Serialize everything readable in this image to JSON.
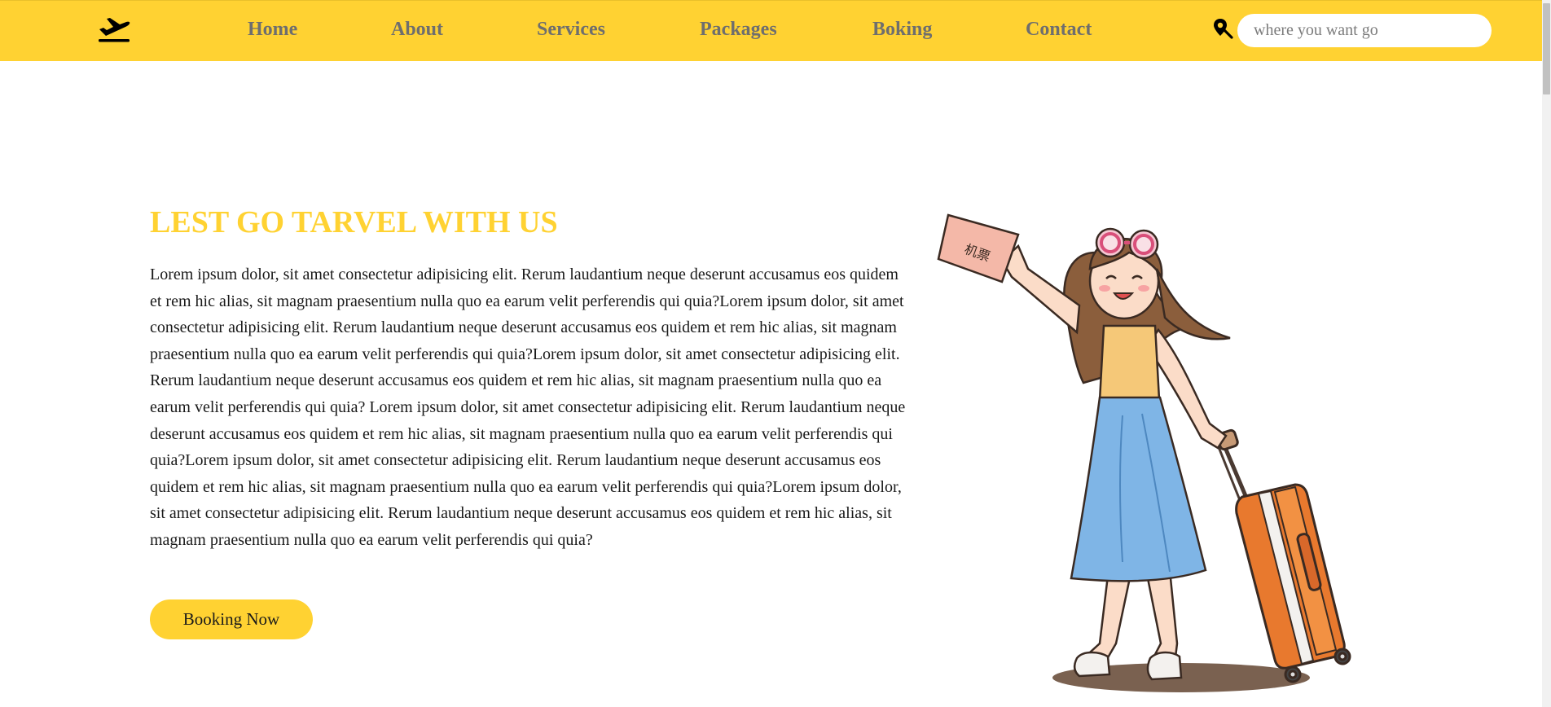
{
  "header": {
    "logo_icon": "plane-departure-icon",
    "nav": [
      {
        "label": "Home"
      },
      {
        "label": "About"
      },
      {
        "label": "Services"
      },
      {
        "label": "Packages"
      },
      {
        "label": "Boking"
      },
      {
        "label": "Contact"
      }
    ],
    "search": {
      "icon": "location-search-icon",
      "placeholder": "where you want go",
      "value": ""
    }
  },
  "hero": {
    "title": "LEST GO TARVEL WITH US",
    "body": "Lorem ipsum dolor, sit amet consectetur adipisicing elit. Rerum laudantium neque deserunt accusamus eos quidem et rem hic alias, sit magnam praesentium nulla quo ea earum velit perferendis qui quia?Lorem ipsum dolor, sit amet consectetur adipisicing elit. Rerum laudantium neque deserunt accusamus eos quidem et rem hic alias, sit magnam praesentium nulla quo ea earum velit perferendis qui quia?Lorem ipsum dolor, sit amet consectetur adipisicing elit. Rerum laudantium neque deserunt accusamus eos quidem et rem hic alias, sit magnam praesentium nulla quo ea earum velit perferendis qui quia? Lorem ipsum dolor, sit amet consectetur adipisicing elit. Rerum laudantium neque deserunt accusamus eos quidem et rem hic alias, sit magnam praesentium nulla quo ea earum velit perferendis qui quia?Lorem ipsum dolor, sit amet consectetur adipisicing elit. Rerum laudantium neque deserunt accusamus eos quidem et rem hic alias, sit magnam praesentium nulla quo ea earum velit perferendis qui quia?Lorem ipsum dolor, sit amet consectetur adipisicing elit. Rerum laudantium neque deserunt accusamus eos quidem et rem hic alias, sit magnam praesentium nulla quo ea earum velit perferendis qui quia?",
    "button_label": "Booking Now",
    "illustration": "girl-traveler-with-suitcase-illustration",
    "ticket_text": "机票"
  },
  "colors": {
    "accent": "#ffd232",
    "nav_text": "#6e6e6e",
    "body_text": "#1a1a1a"
  }
}
